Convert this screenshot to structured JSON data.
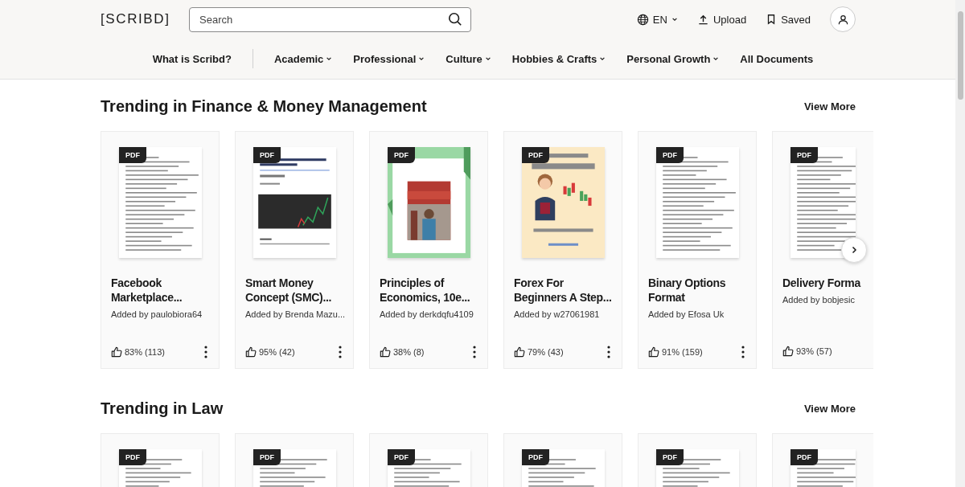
{
  "header": {
    "logo": "[SCRIBD]",
    "search": {
      "placeholder": "Search"
    },
    "language": "EN",
    "upload": "Upload",
    "saved": "Saved"
  },
  "nav": [
    {
      "label": "What is Scribd?",
      "dropdown": false
    },
    {
      "label": "Academic",
      "dropdown": true
    },
    {
      "label": "Professional",
      "dropdown": true
    },
    {
      "label": "Culture",
      "dropdown": true
    },
    {
      "label": "Hobbies & Crafts",
      "dropdown": true
    },
    {
      "label": "Personal Growth",
      "dropdown": true
    },
    {
      "label": "All Documents",
      "dropdown": false
    }
  ],
  "sections": [
    {
      "title": "Trending in Finance & Money Management",
      "view_more": "View More",
      "cards": [
        {
          "badge": "PDF",
          "title": "Facebook Marketplace...",
          "added_by": "Added by paulobiora64",
          "rating": "83% (113)"
        },
        {
          "badge": "PDF",
          "title": "Smart Money Concept (SMC)...",
          "added_by": "Added by Brenda Mazu...",
          "rating": "95% (42)"
        },
        {
          "badge": "PDF",
          "title": "Principles of Economics, 10e...",
          "added_by": "Added by derkdqfu4109",
          "rating": "38% (8)"
        },
        {
          "badge": "PDF",
          "title": "Forex For Beginners A Step...",
          "added_by": "Added by w27061981",
          "rating": "79% (43)"
        },
        {
          "badge": "PDF",
          "title": "Binary Options Format",
          "added_by": "Added by Efosa Uk",
          "rating": "91% (159)"
        },
        {
          "badge": "PDF",
          "title": "Delivery Forma",
          "added_by": "Added by bobjesic",
          "rating": "93% (57)"
        }
      ]
    },
    {
      "title": "Trending in Law",
      "view_more": "View More",
      "cards": [
        {
          "badge": "PDF"
        },
        {
          "badge": "PDF"
        },
        {
          "badge": "PDF"
        },
        {
          "badge": "PDF"
        },
        {
          "badge": "PDF"
        },
        {
          "badge": "PDF"
        }
      ]
    }
  ]
}
